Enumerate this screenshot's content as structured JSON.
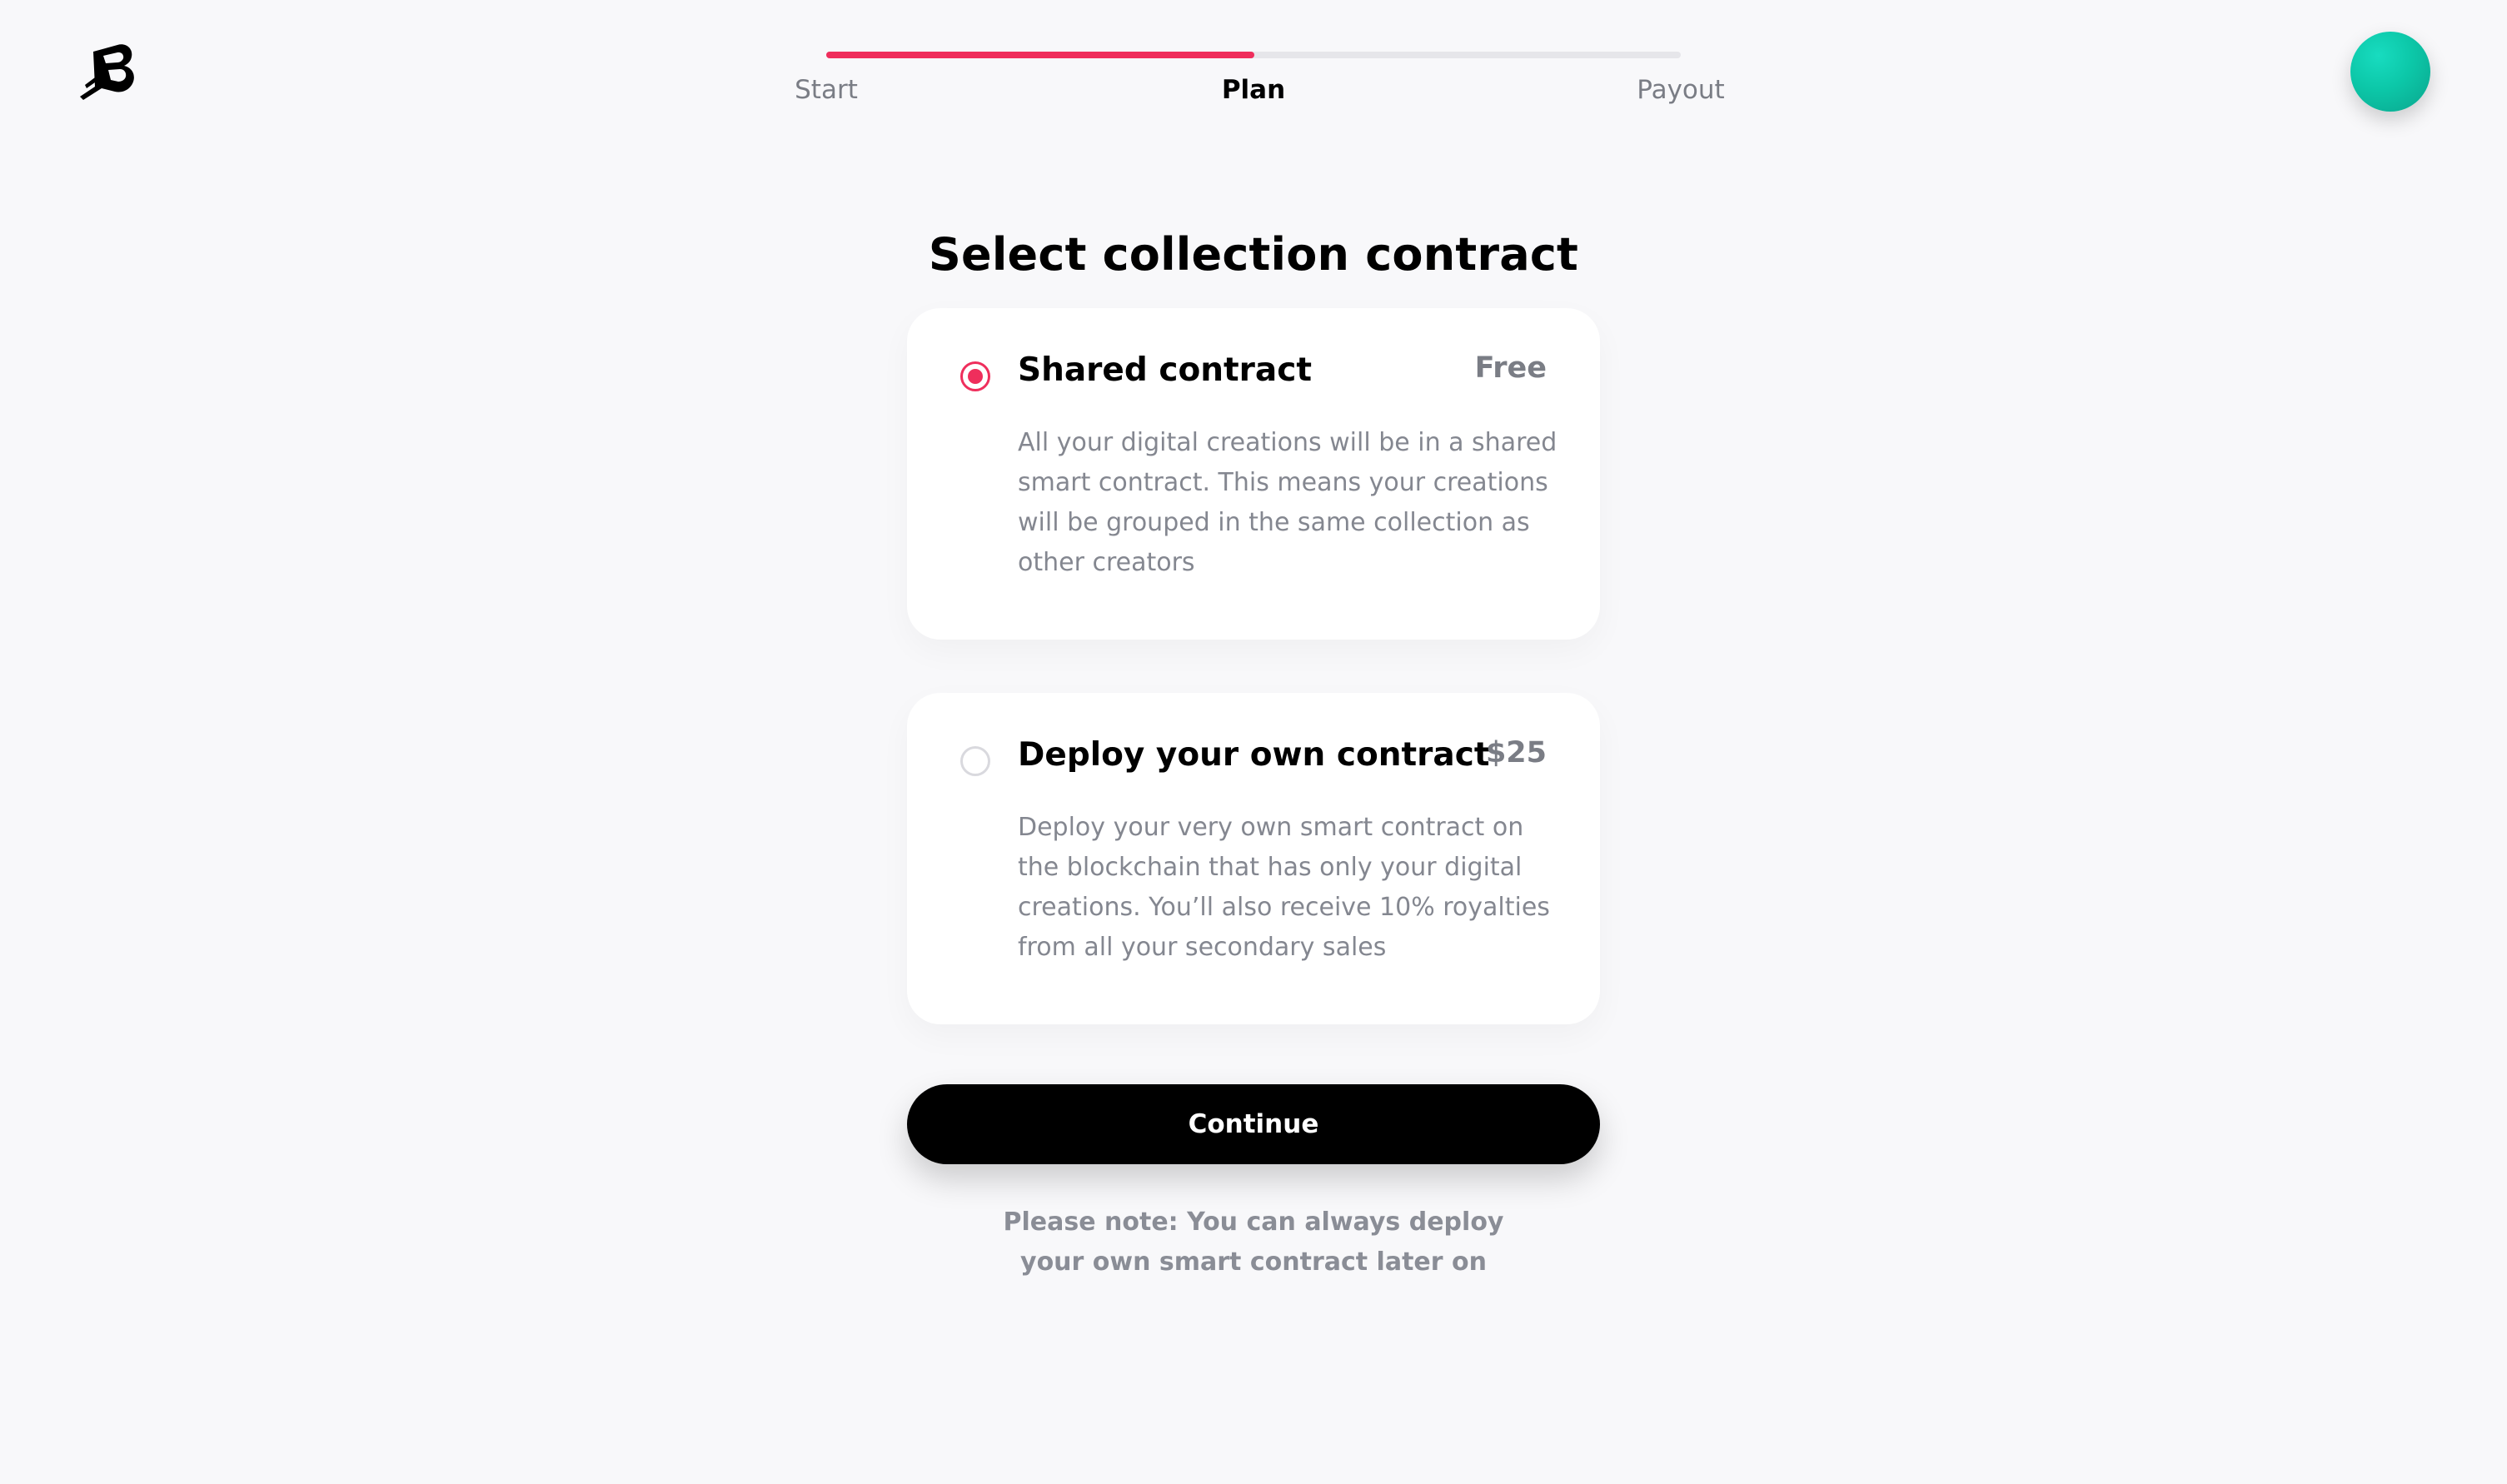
{
  "header": {
    "logo_icon": "brand-logo-icon",
    "avatar_color": "#0cc7a8"
  },
  "stepper": {
    "steps": [
      {
        "label": "Start"
      },
      {
        "label": "Plan"
      },
      {
        "label": "Payout"
      }
    ],
    "active_step": "Plan",
    "progress_fraction": 0.5,
    "accent": "#ef2e5c"
  },
  "page": {
    "title": "Select collection contract"
  },
  "options": [
    {
      "title": "Shared contract",
      "price": "Free",
      "description": "All your digital creations will be in a shared smart contract. This means your creations will be grouped in the same collection as other creators",
      "selected": true
    },
    {
      "title": "Deploy your own contract",
      "price": "$25",
      "description": "Deploy your very own smart contract on the blockchain that has only your digital creations. You’ll also receive 10% royalties from all your secondary sales",
      "selected": false
    }
  ],
  "actions": {
    "continue_label": "Continue"
  },
  "note": "Please note: You can always deploy your own smart contract later on",
  "colors": {
    "background": "#f8f8fa",
    "text_muted": "#848790",
    "button": "#000000"
  }
}
